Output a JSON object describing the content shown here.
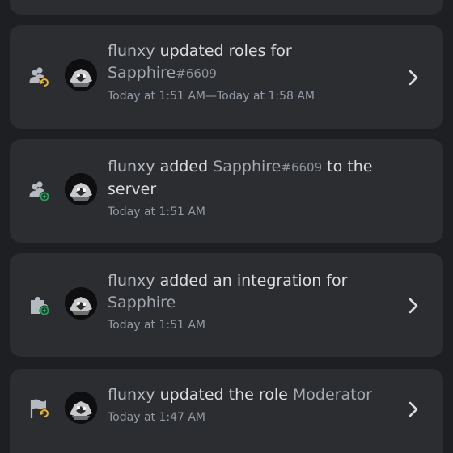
{
  "entries": [
    {
      "icon": "member-role-update-icon",
      "user": "flunxy",
      "action": " updated roles for",
      "target": "Sapphire",
      "discriminator": "#6609",
      "suffix": "",
      "timestamp": "Today at 1:51 AM—Today at 1:58 AM",
      "has_chevron": true
    },
    {
      "icon": "bot-add-icon",
      "user": "flunxy",
      "action": " added ",
      "target": "Sapphire",
      "discriminator": "#6609",
      "suffix": " to the server",
      "timestamp": "Today at 1:51 AM",
      "has_chevron": false
    },
    {
      "icon": "integration-create-icon",
      "user": "flunxy",
      "action": " added an integration for ",
      "target": "Sapphire",
      "discriminator": "",
      "suffix": "",
      "timestamp": "Today at 1:51 AM",
      "has_chevron": true
    },
    {
      "icon": "role-update-icon",
      "user": "flunxy",
      "action": " updated the role ",
      "target": "Moderator",
      "discriminator": "",
      "suffix": "",
      "timestamp": "Today at 1:47 AM",
      "has_chevron": true
    }
  ],
  "colors": {
    "background": "#1e1f22",
    "card": "#2b2d31",
    "update_badge": "#f0b232",
    "create_badge": "#23a55a",
    "icon": "#b5bac1"
  }
}
